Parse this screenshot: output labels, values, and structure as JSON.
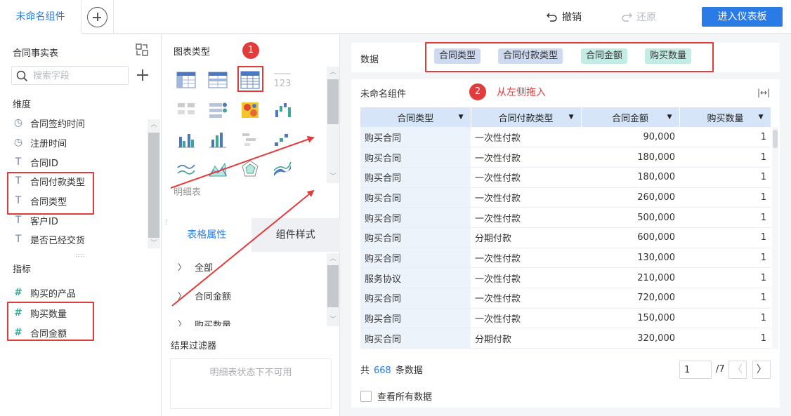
{
  "topbar": {
    "tab_label": "未命名组件",
    "undo_label": "撤销",
    "redo_label": "还原",
    "enter_label": "进入仪表板"
  },
  "left": {
    "table_name": "合同事实表",
    "search_placeholder": "搜索字段",
    "dim_title": "维度",
    "dimensions": [
      {
        "label": "合同签约时间",
        "icon": "clock-icon"
      },
      {
        "label": "注册时间",
        "icon": "clock-icon"
      },
      {
        "label": "合同ID",
        "icon": "text-type-icon"
      },
      {
        "label": "合同付款类型",
        "icon": "text-type-icon"
      },
      {
        "label": "合同类型",
        "icon": "text-type-icon"
      },
      {
        "label": "客户ID",
        "icon": "text-type-icon"
      },
      {
        "label": "是否已经交货",
        "icon": "text-type-icon"
      }
    ],
    "meas_title": "指标",
    "measures": [
      {
        "label": "购买的产品",
        "icon": "hash-icon"
      },
      {
        "label": "购买数量",
        "icon": "hash-icon"
      },
      {
        "label": "合同金额",
        "icon": "hash-icon"
      }
    ]
  },
  "middle": {
    "chart_type_title": "图表类型",
    "selected_chart_caption": "明细表",
    "badge_1": "1",
    "tab_table_props": "表格属性",
    "tab_component_style": "组件样式",
    "props": [
      "全部",
      "合同金额",
      "购买数量"
    ],
    "filter_title": "结果过滤器",
    "filter_disabled_text": "明细表状态下不可用"
  },
  "right": {
    "data_label": "数据",
    "pills": [
      {
        "label": "合同类型",
        "kind": "dim"
      },
      {
        "label": "合同付款类型",
        "kind": "dim"
      },
      {
        "label": "合同金额",
        "kind": "meas"
      },
      {
        "label": "购买数量",
        "kind": "meas"
      }
    ],
    "component_title": "未命名组件",
    "badge_2": "2",
    "drag_hint": "从左侧拖入",
    "columns": [
      "合同类型",
      "合同付款类型",
      "合同金额",
      "购买数量"
    ],
    "rows": [
      [
        "购买合同",
        "一次性付款",
        "90,000",
        "1"
      ],
      [
        "购买合同",
        "一次性付款",
        "180,000",
        "1"
      ],
      [
        "购买合同",
        "一次性付款",
        "180,000",
        "1"
      ],
      [
        "购买合同",
        "一次性付款",
        "260,000",
        "1"
      ],
      [
        "购买合同",
        "一次性付款",
        "500,000",
        "1"
      ],
      [
        "购买合同",
        "分期付款",
        "600,000",
        "1"
      ],
      [
        "购买合同",
        "一次性付款",
        "130,000",
        "1"
      ],
      [
        "服务协议",
        "一次性付款",
        "210,000",
        "1"
      ],
      [
        "购买合同",
        "一次性付款",
        "720,000",
        "1"
      ],
      [
        "购买合同",
        "一次性付款",
        "150,000",
        "1"
      ],
      [
        "购买合同",
        "分期付款",
        "320,000",
        "1"
      ]
    ],
    "total_prefix": "共",
    "total_count": "668",
    "total_suffix": "条数据",
    "page_value": "1",
    "page_total": "/7",
    "view_all_label": "查看所有数据"
  },
  "colors": {
    "accent": "#2a7be6",
    "annotation_red": "#e23b3b",
    "dim_pill": "#cddaf0",
    "measure_pill": "#c3ece4",
    "header_bg": "#d6e5f7"
  }
}
